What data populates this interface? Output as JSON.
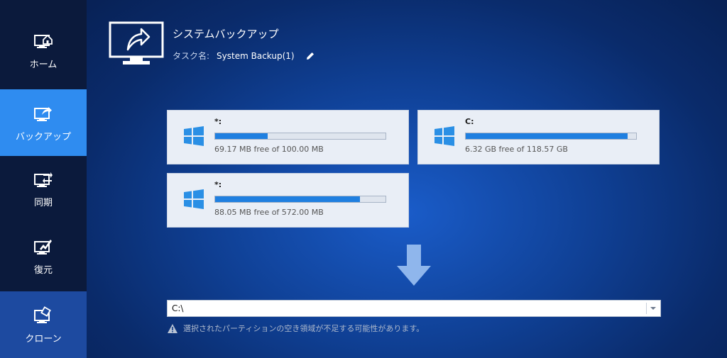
{
  "sidebar": {
    "items": [
      {
        "label": "ホーム",
        "icon": "home-monitor-icon"
      },
      {
        "label": "バックアップ",
        "icon": "backup-monitor-icon"
      },
      {
        "label": "同期",
        "icon": "sync-monitor-icon"
      },
      {
        "label": "復元",
        "icon": "restore-monitor-icon"
      },
      {
        "label": "クローン",
        "icon": "clone-monitor-icon"
      }
    ],
    "active_index": 1
  },
  "header": {
    "title": "システムバックアップ",
    "task_label": "タスク名:",
    "task_value": "System Backup(1)"
  },
  "partitions": [
    {
      "name": "*:",
      "free_text": "69.17 MB free of 100.00 MB",
      "used_fraction": 0.31
    },
    {
      "name": "C:",
      "free_text": "6.32 GB free of 118.57 GB",
      "used_fraction": 0.95
    },
    {
      "name": "*:",
      "free_text": "88.05 MB free of 572.00 MB",
      "used_fraction": 0.85
    }
  ],
  "destination": {
    "value": "C:\\"
  },
  "warning": {
    "text": "選択されたパーティションの空き領域が不足する可能性があります。"
  },
  "colors": {
    "accent": "#2f8cf0",
    "bar_fill": "#1f7fe0",
    "sidebar_bg": "#0b1a3c"
  }
}
